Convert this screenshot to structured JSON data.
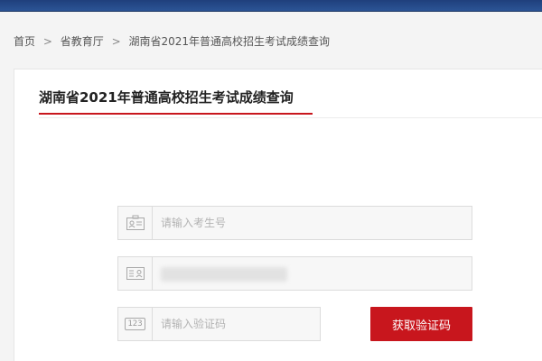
{
  "breadcrumb": {
    "items": [
      "首页",
      "省教育厅",
      "湖南省2021年普通高校招生考试成绩查询"
    ],
    "separator": ">"
  },
  "page": {
    "title": "湖南省2021年普通高校招生考试成绩查询"
  },
  "form": {
    "exam_number": {
      "placeholder": "请输入考生号",
      "icon": "id-card-icon"
    },
    "id_number": {
      "icon": "id-document-icon"
    },
    "verify_code": {
      "placeholder": "请输入验证码",
      "icon_text": "123",
      "icon": "numeric-code-icon"
    },
    "get_code_label": "获取验证码"
  },
  "colors": {
    "accent": "#c8161d",
    "banner": "#2c5596"
  }
}
